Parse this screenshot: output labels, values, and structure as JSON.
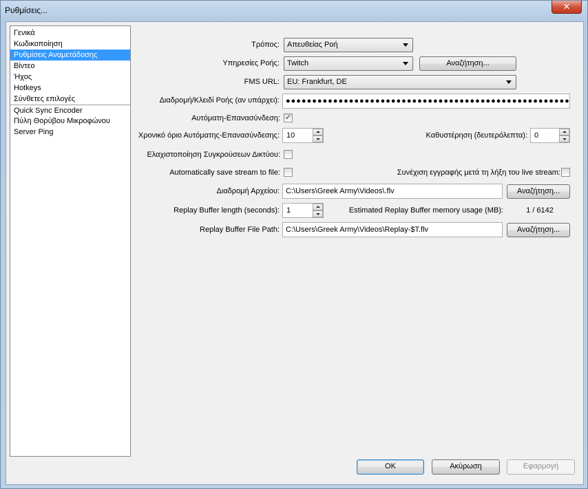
{
  "window": {
    "title": "Ρυθμίσεις...",
    "close_glyph": "✕"
  },
  "nav": {
    "items": [
      {
        "label": "Γενικά"
      },
      {
        "label": "Κωδικοποίηση"
      },
      {
        "label": "Ρυθμίσεις Αναμετάδοσης",
        "selected": true
      },
      {
        "label": "Βίντεο"
      },
      {
        "label": "Ήχος"
      },
      {
        "label": "Hotkeys"
      },
      {
        "label": "Σύνθετες επιλογές"
      },
      {
        "label": "Quick Sync Encoder"
      },
      {
        "label": "Πύλη Θορύβου Μικροφώνου"
      },
      {
        "label": "Server Ping"
      }
    ]
  },
  "form": {
    "mode_label": "Τρόπος:",
    "mode_value": "Απευθείας Ροή",
    "service_label": "Υπηρεσίες Ροής:",
    "service_value": "Twitch",
    "search_button": "Αναζήτηση...",
    "fms_label": "FMS URL:",
    "fms_value": "EU: Frankfurt, DE",
    "key_label": "Διαδρομή/Κλειδί Ροής (αν υπάρχει):",
    "key_value": "●●●●●●●●●●●●●●●●●●●●●●●●●●●●●●●●●●●●●●●●●●●●●●●●●●●●●●●●●●●",
    "auto_reconnect_label": "Αυτόματη-Επανασύνδεση:",
    "auto_reconnect_checked": "✓",
    "reconnect_timeout_label": "Χρονικό όριο Αυτόματης-Επανασύνδεσης:",
    "reconnect_timeout_value": "10",
    "delay_label": "Καθυστέρηση (δευτερόλεπτα):",
    "delay_value": "0",
    "minimize_congestion_label": "Ελαχιστοποίηση Συγκρούσεων Δικτύου:",
    "auto_save_label": "Automatically save stream to file:",
    "continue_recording_label": "Συνέχιση εγγραφής μετά τη λήξη του live stream:",
    "file_path_label": "Διαδρομή Αρχείου:",
    "file_path_value": "C:\\Users\\Greek Army\\Videos\\.flv",
    "replay_length_label": "Replay Buffer length (seconds):",
    "replay_length_value": "1",
    "replay_memory_label": "Estimated Replay Buffer memory usage (MB):",
    "replay_memory_value": "1 / 6142",
    "replay_path_label": "Replay Buffer File Path:",
    "replay_path_value": "C:\\Users\\Greek Army\\Videos\\Replay-$T.flv"
  },
  "buttons": {
    "ok": "OK",
    "cancel": "Ακύρωση",
    "apply": "Εφαρμογή"
  }
}
